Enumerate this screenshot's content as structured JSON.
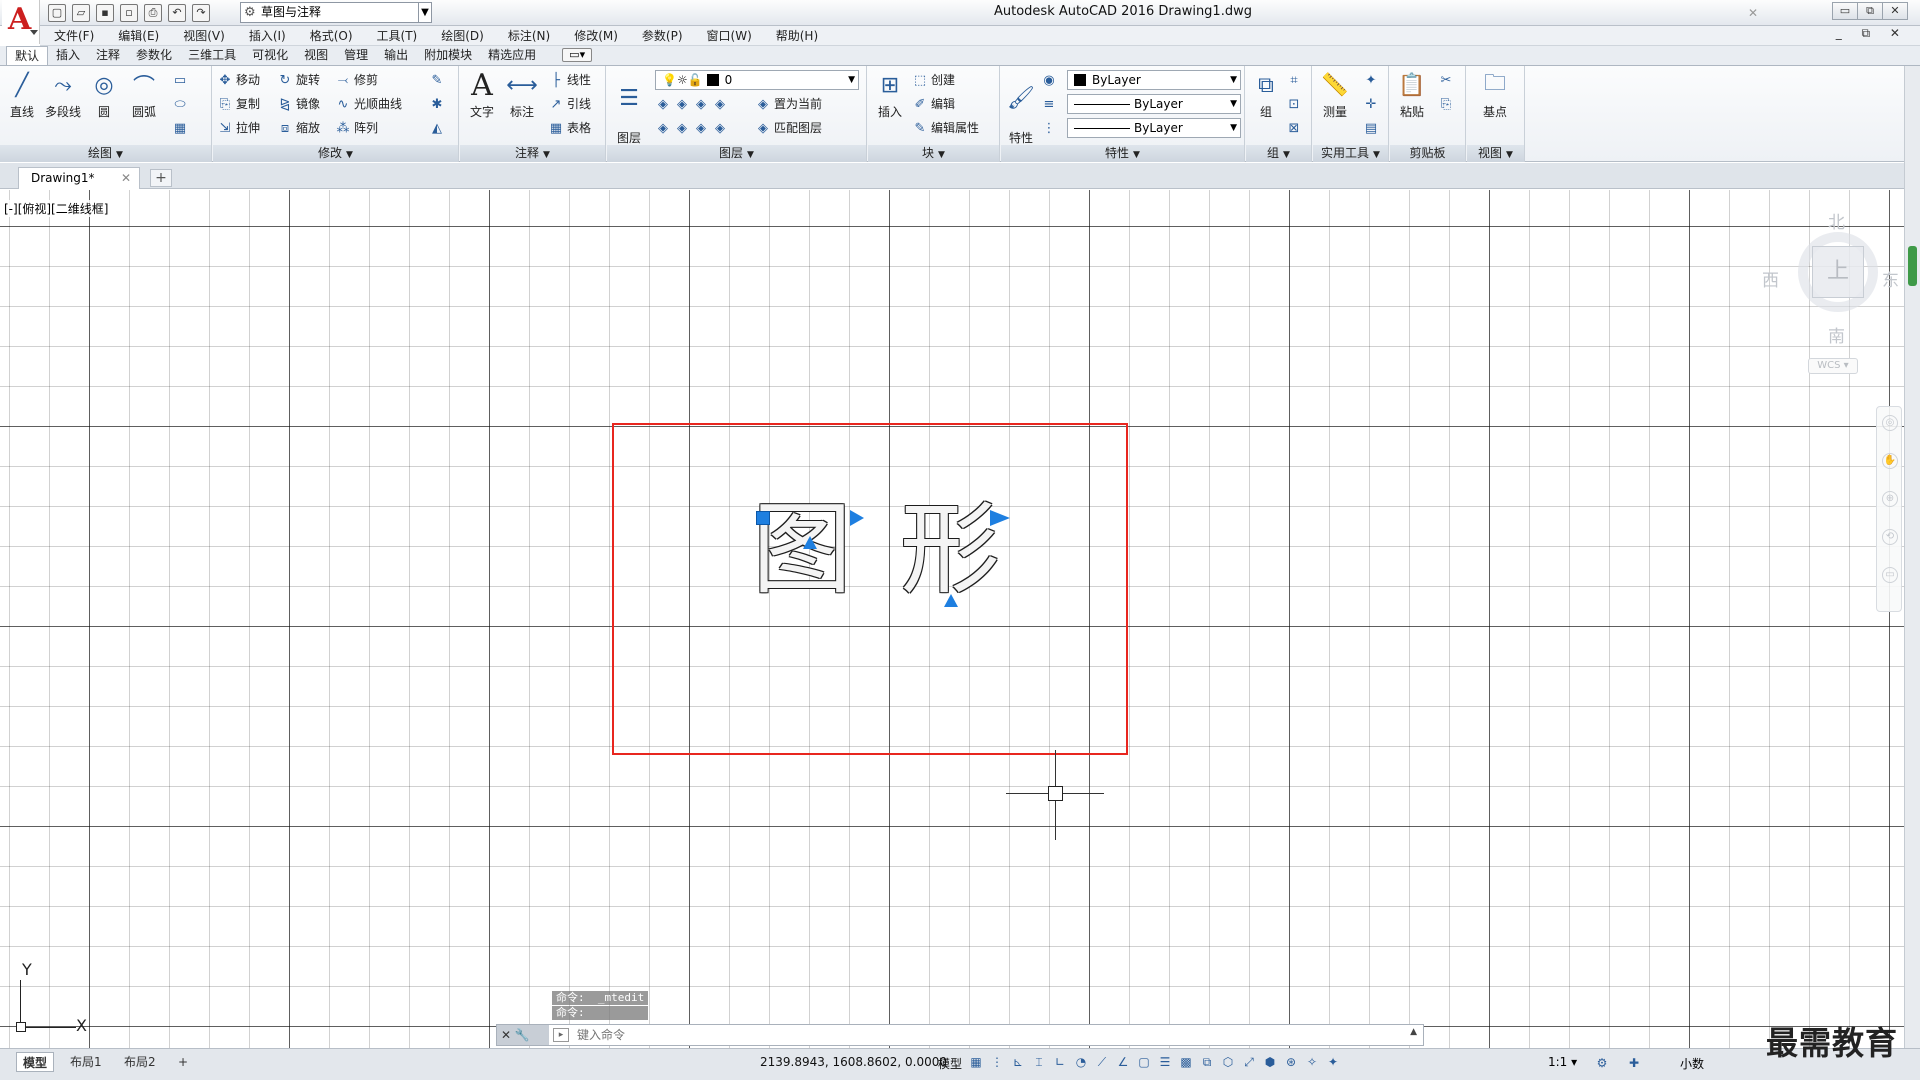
{
  "title_bar": {
    "window_title": "Autodesk AutoCAD 2016    Drawing1.dwg",
    "workspace": "草图与注释",
    "info_close": "✕",
    "controls": [
      "▭",
      "⧉",
      "✕"
    ]
  },
  "menu": {
    "items": [
      "文件(F)",
      "编辑(E)",
      "视图(V)",
      "插入(I)",
      "格式(O)",
      "工具(T)",
      "绘图(D)",
      "标注(N)",
      "修改(M)",
      "参数(P)",
      "窗口(W)",
      "帮助(H)"
    ],
    "doc_controls": "_ ⧉ ✕"
  },
  "ribbon_tabs": {
    "items": [
      "默认",
      "插入",
      "注释",
      "参数化",
      "三维工具",
      "可视化",
      "视图",
      "管理",
      "输出",
      "附加模块",
      "精选应用"
    ],
    "active": "默认",
    "extra": "▭▾"
  },
  "ribbon": {
    "draw": {
      "label": "绘图",
      "line": "直线",
      "polyline": "多段线",
      "circle": "圆",
      "arc": "圆弧"
    },
    "modify": {
      "label": "修改",
      "move": "移动",
      "rotate": "旋转",
      "trim": "修剪",
      "copy": "复制",
      "mirror": "镜像",
      "fillet": "光顺曲线",
      "stretch": "拉伸",
      "scale": "缩放",
      "array": "阵列"
    },
    "annotation": {
      "label": "注释",
      "text": "文字",
      "dimension": "标注",
      "linear": "线性",
      "leader": "引线",
      "table": "表格"
    },
    "layers": {
      "label": "图层",
      "layer_props": "图层\n特性",
      "current_layer": "0",
      "set_current": "置为当前",
      "match_layer": "匹配图层"
    },
    "block": {
      "label": "块",
      "insert": "插入",
      "create": "创建",
      "edit": "编辑",
      "edit_attr": "编辑属性"
    },
    "properties": {
      "label": "特性",
      "match": "特性\n匹配",
      "color": "ByLayer",
      "linetype": "ByLayer",
      "lineweight": "ByLayer"
    },
    "groups": {
      "label": "组",
      "group": "组"
    },
    "utilities": {
      "label": "实用工具",
      "measure": "测量"
    },
    "clipboard": {
      "label": "剪贴板",
      "paste": "粘贴"
    },
    "view": {
      "label": "视图",
      "base": "基点"
    }
  },
  "doc_tab": {
    "name": "Drawing1*",
    "close": "✕",
    "new": "+"
  },
  "canvas": {
    "viewport_label": "[-][俯视][二维线框]",
    "mtext": [
      "图",
      "形"
    ],
    "viewcube": {
      "north": "北",
      "south": "南",
      "east": "东",
      "west": "西",
      "face": "上",
      "wcs": "WCS ▾"
    },
    "ucs": {
      "x": "X",
      "y": "Y"
    }
  },
  "command": {
    "history": [
      "命令:  _mtedit",
      "命令:"
    ],
    "placeholder": "键入命令",
    "grip_icons": "✕ 🔧",
    "prompt_icon": "▸"
  },
  "status_bar": {
    "tabs": [
      "模型",
      "布局1",
      "布局2"
    ],
    "active_tab": "模型",
    "new_tab": "+",
    "coordinates": "2139.8943, 1608.8602, 0.0000",
    "mode": "模型",
    "scale": "1:1 ▾",
    "units": "小数"
  },
  "watermark": "最需教育",
  "colors": {
    "selection": "#e8261f",
    "grip": "#1e7fe0",
    "accent": "#2a5d9a"
  }
}
